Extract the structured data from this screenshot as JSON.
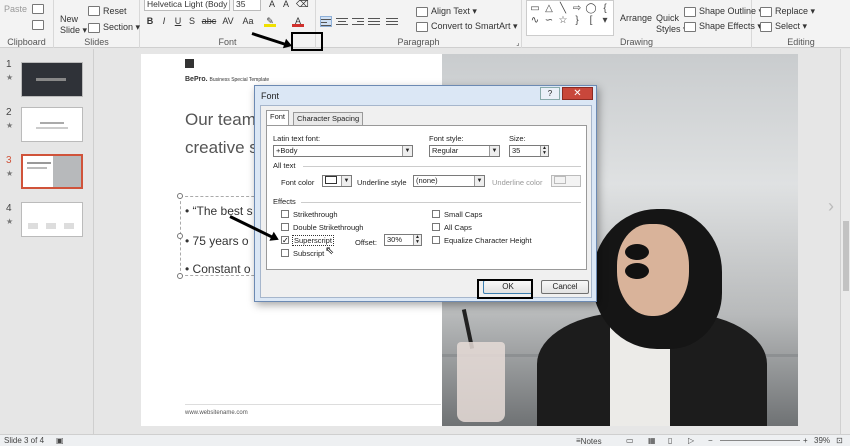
{
  "ribbon": {
    "clipboard": {
      "paste": "Paste",
      "label": "Clipboard"
    },
    "slides": {
      "new_slide": "New",
      "new_slide_2": "Slide ▾",
      "reset": "Reset",
      "section": "Section ▾",
      "label": "Slides"
    },
    "font": {
      "name": "Helvetica Light (Body",
      "size": "35",
      "label": "Font",
      "bold": "B",
      "italic": "I",
      "underline": "U",
      "strike": "S",
      "shadow": "abc",
      "spacing": "AV",
      "case": "Aa"
    },
    "paragraph": {
      "align_text": "Align Text ▾",
      "smartart": "Convert to SmartArt ▾",
      "label": "Paragraph"
    },
    "drawing": {
      "arrange": "Arrange",
      "quick_styles": "Quick",
      "quick_styles_2": "Styles ▾",
      "shape_outline": "Shape Outline ▾",
      "shape_effects": "Shape Effects ▾",
      "label": "Drawing"
    },
    "editing": {
      "replace": "Replace ▾",
      "select": "Select ▾",
      "label": "Editing"
    }
  },
  "thumbnails": [
    {
      "num": "1",
      "star": "★"
    },
    {
      "num": "2",
      "star": "★"
    },
    {
      "num": "3",
      "star": "★"
    },
    {
      "num": "4",
      "star": "★"
    }
  ],
  "slide": {
    "brand": "BePro.",
    "brand_sub": "Business Special Template",
    "heading": "Our team\ncreative s",
    "bullets": [
      "“The best s",
      "75 years o",
      "Constant o"
    ],
    "url": "www.websitename.com"
  },
  "dialog": {
    "title": "Font",
    "help": "?",
    "close": "✕",
    "tabs": [
      "Font",
      "Character Spacing"
    ],
    "latin_label": "Latin text font:",
    "latin_value": "+Body",
    "style_label": "Font style:",
    "style_value": "Regular",
    "size_label": "Size:",
    "size_value": "35",
    "all_text": "All text",
    "font_color_label": "Font color",
    "underline_style_label": "Underline style",
    "underline_style_value": "(none)",
    "underline_color_label": "Underline color",
    "effects": "Effects",
    "effects_left": [
      {
        "label": "Strikethrough",
        "checked": false
      },
      {
        "label": "Double Strikethrough",
        "checked": false
      },
      {
        "label": "Superscript",
        "checked": true
      },
      {
        "label": "Subscript",
        "checked": false
      }
    ],
    "effects_right": [
      {
        "label": "Small Caps",
        "checked": false
      },
      {
        "label": "All Caps",
        "checked": false
      },
      {
        "label": "Equalize Character Height",
        "checked": false
      }
    ],
    "offset_label": "Offset:",
    "offset_value": "30%",
    "ok": "OK",
    "cancel": "Cancel"
  },
  "status": {
    "slide_of": "Slide 3 of 4",
    "notes": "Notes",
    "zoom": "39%"
  },
  "colors": {
    "accent": "#d0533a",
    "dialog_frame": "#dbe7f5",
    "close_red": "#c8473b"
  }
}
